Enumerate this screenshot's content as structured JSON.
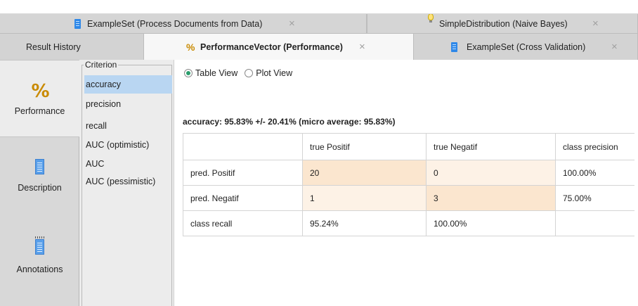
{
  "tabs_top": [
    {
      "label": "ExampleSet (Process Documents from Data)",
      "icon": "document-icon",
      "close": "×"
    },
    {
      "label": "SimpleDistribution (Naive Bayes)",
      "icon": "lightbulb-icon",
      "close": "×"
    }
  ],
  "tabs_bottom": [
    {
      "label": "Result History"
    },
    {
      "label": "PerformanceVector (Performance)",
      "icon": "percent-icon",
      "close": "×",
      "active": true
    },
    {
      "label": "ExampleSet (Cross Validation)",
      "icon": "document-icon",
      "close": "×"
    }
  ],
  "sidebar": {
    "items": [
      {
        "label": "Performance",
        "icon": "percent-icon",
        "active": true
      },
      {
        "label": "Description",
        "icon": "document-icon"
      },
      {
        "label": "Annotations",
        "icon": "notepad-icon"
      }
    ]
  },
  "criterion": {
    "legend": "Criterion",
    "items": [
      "accuracy",
      "precision",
      "recall",
      "AUC (optimistic)",
      "AUC",
      "AUC (pessimistic)"
    ],
    "selected": "accuracy"
  },
  "view": {
    "table_view": "Table View",
    "plot_view": "Plot View",
    "selected": "Table View"
  },
  "summary": "accuracy: 95.83% +/- 20.41% (micro average: 95.83%)",
  "table": {
    "headers": [
      "",
      "true Positif",
      "true Negatif",
      "class precision"
    ],
    "rows": [
      [
        "pred. Positif",
        "20",
        "0",
        "100.00%"
      ],
      [
        "pred. Negatif",
        "1",
        "3",
        "75.00%"
      ],
      [
        "class recall",
        "95.24%",
        "100.00%",
        ""
      ]
    ]
  },
  "colors": {
    "selected_item": "#b9d6f2",
    "diagonal_cell": "#fbe6cf",
    "offdiag_cell": "#fdf2e6",
    "radio_on": "#2a9d6c"
  }
}
